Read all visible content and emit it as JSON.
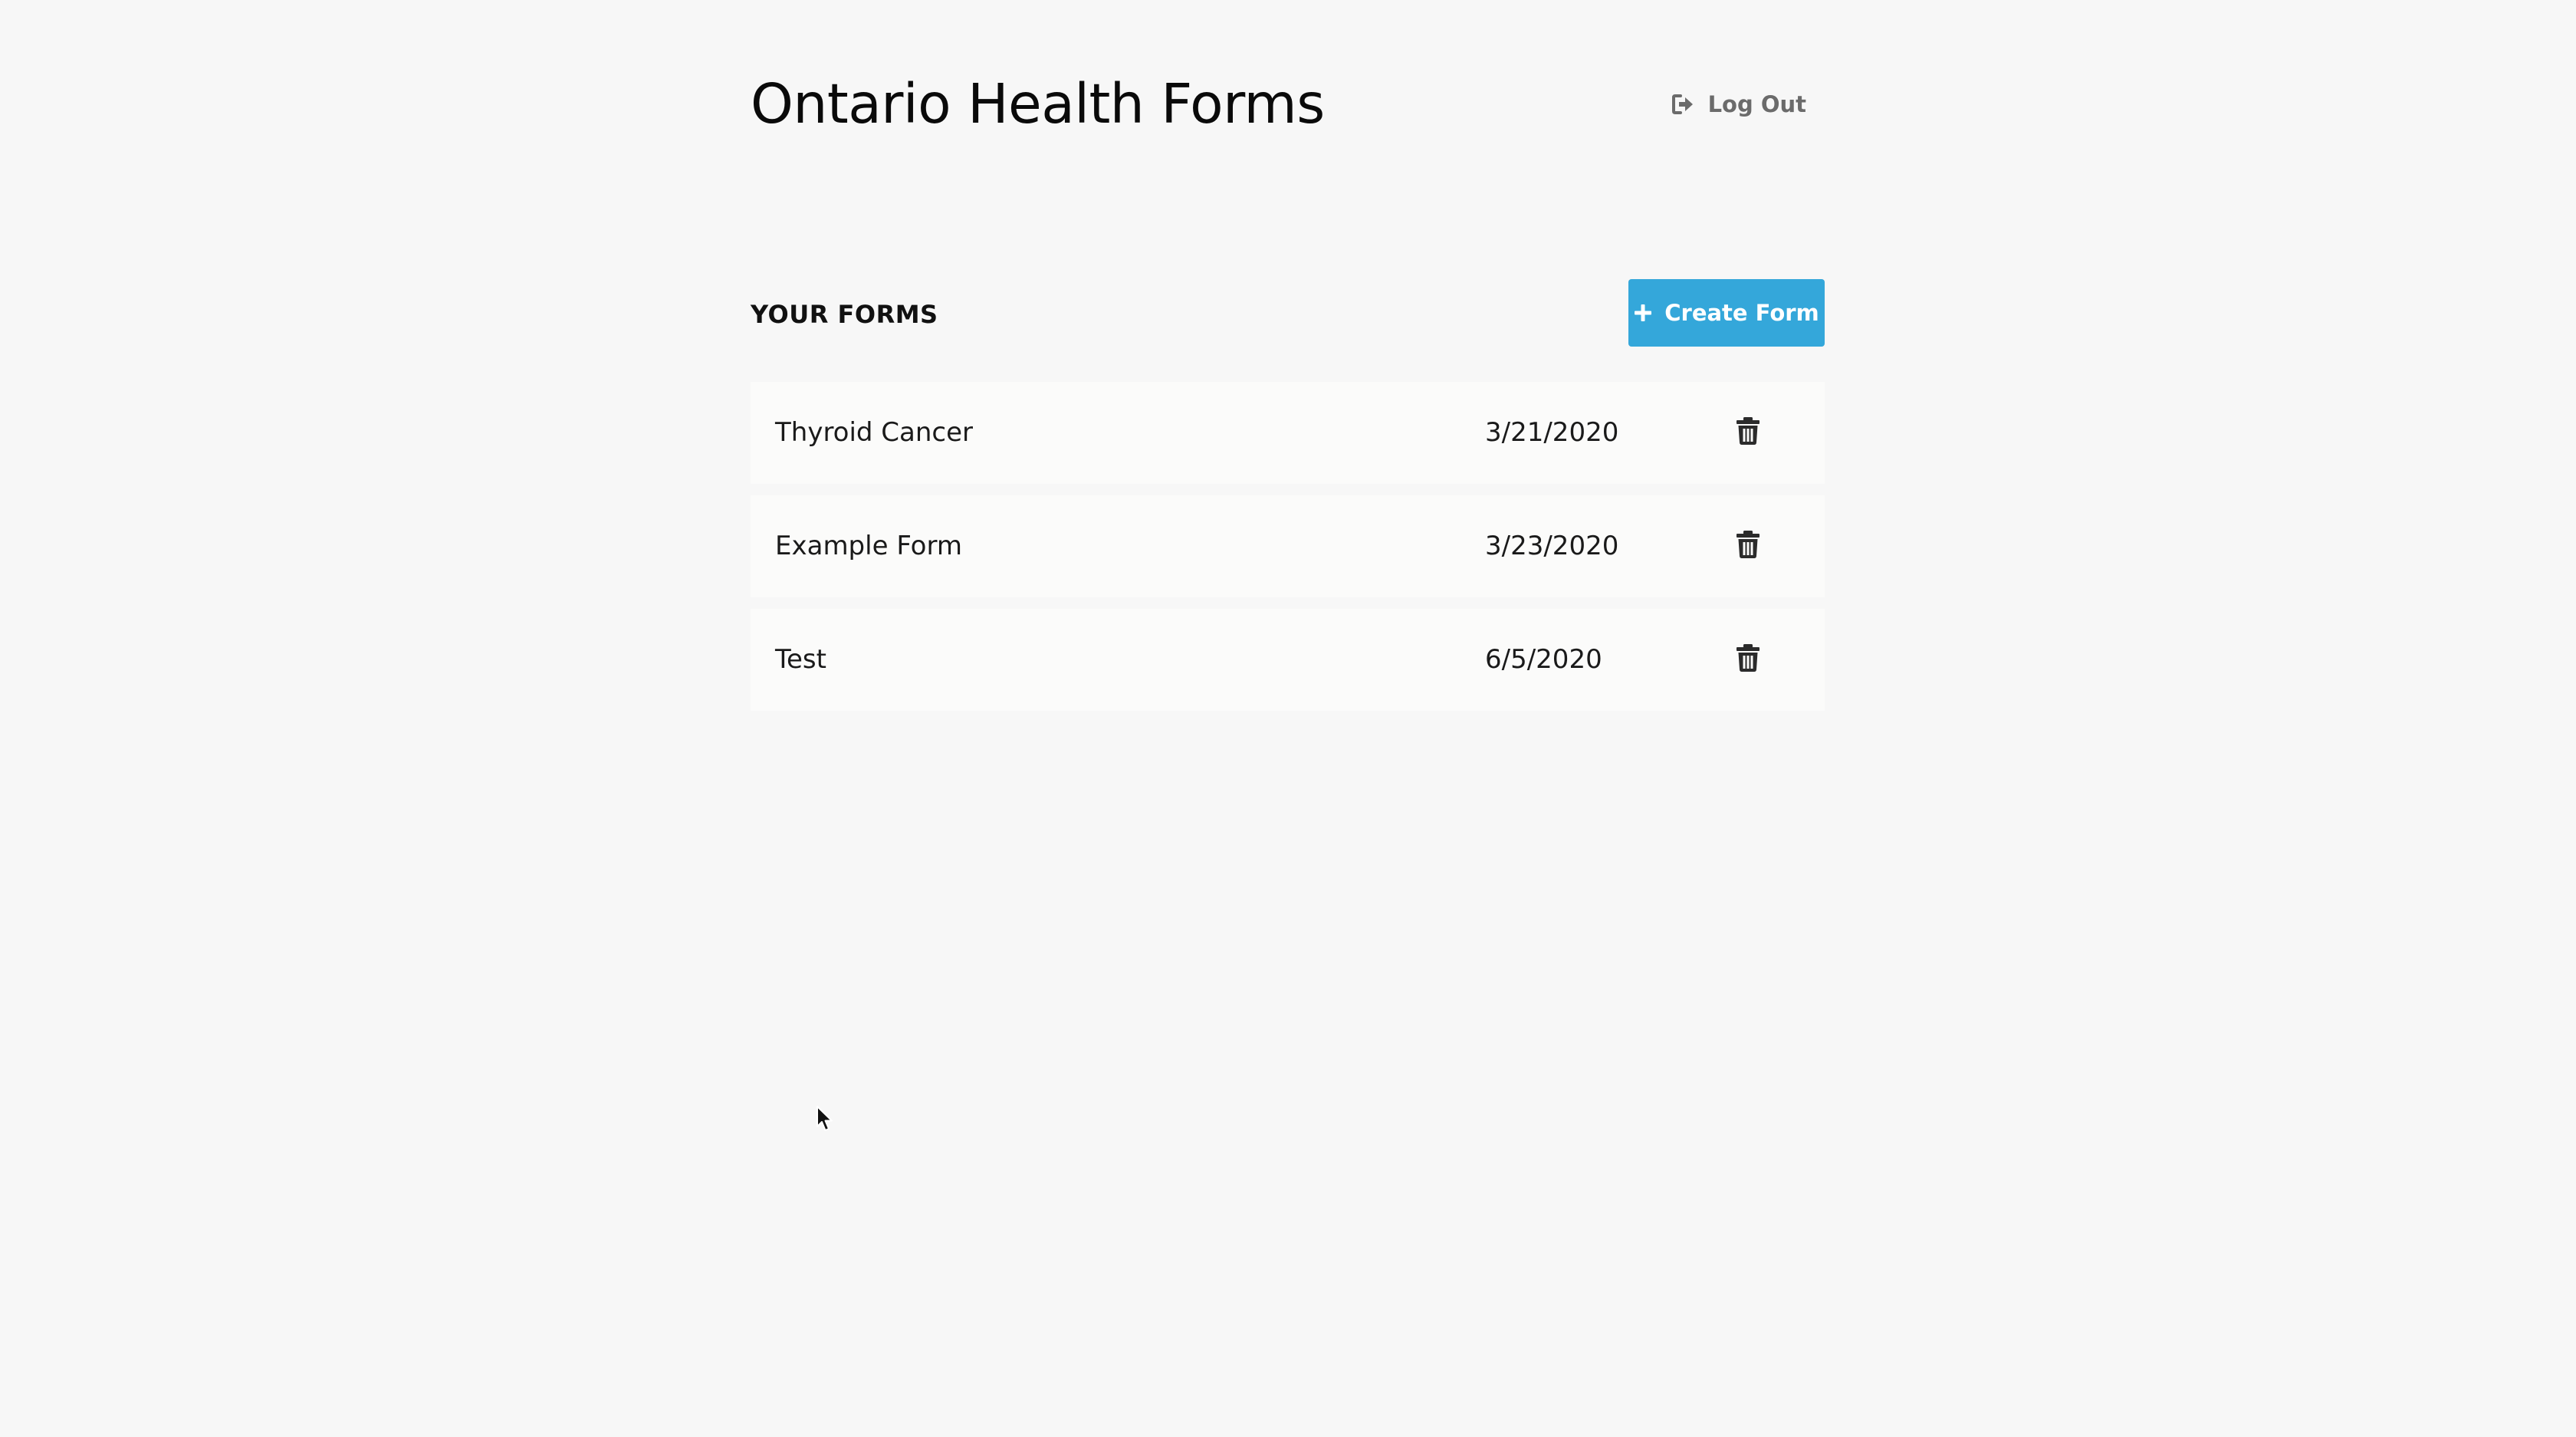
{
  "header": {
    "title": "Ontario Health Forms",
    "logout_label": "Log Out",
    "logout_icon": "sign-out-icon"
  },
  "forms_section": {
    "title": "YOUR FORMS",
    "create_label": "Create Form",
    "create_icon": "plus-icon",
    "accent_color": "#34a7da"
  },
  "forms": [
    {
      "name": "Thyroid Cancer",
      "date": "3/21/2020",
      "action_icon": "trash-icon"
    },
    {
      "name": "Example Form",
      "date": "3/23/2020",
      "action_icon": "trash-icon"
    },
    {
      "name": "Test",
      "date": "6/5/2020",
      "action_icon": "trash-icon"
    }
  ]
}
